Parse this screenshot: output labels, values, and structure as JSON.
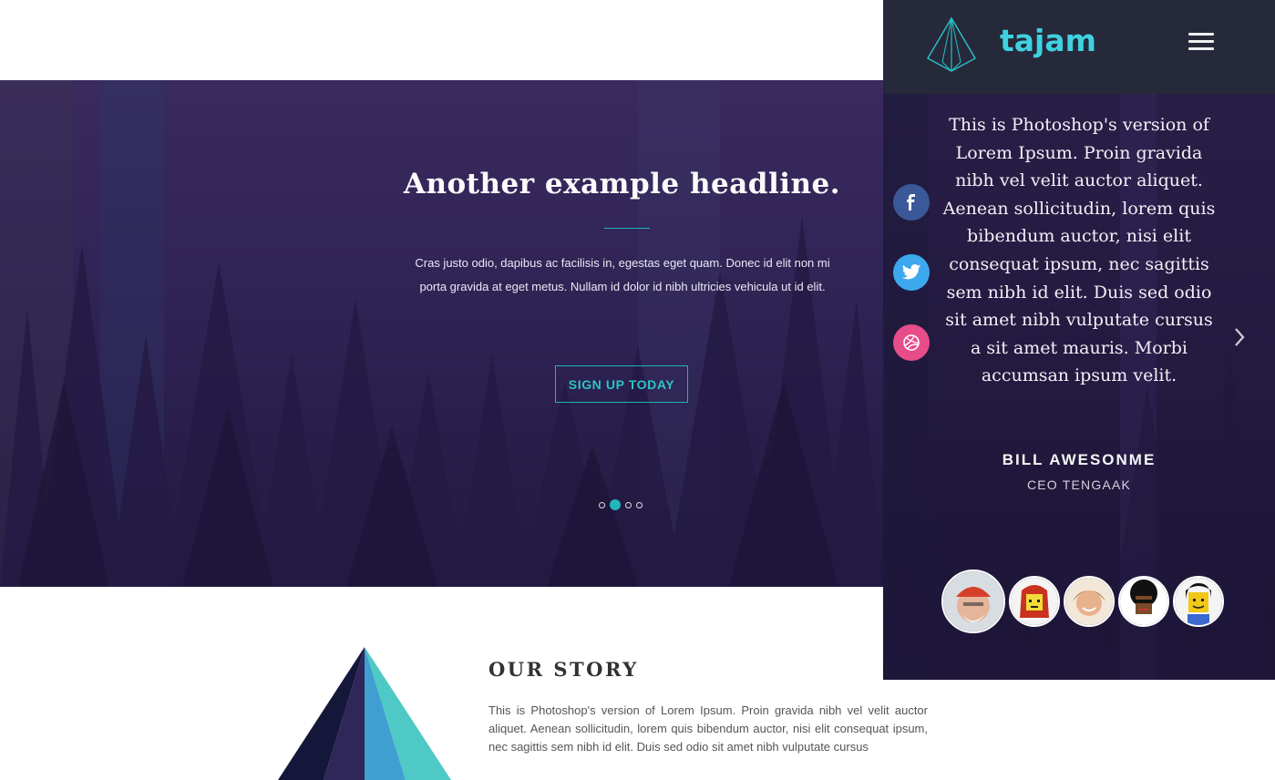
{
  "hero": {
    "title": "Another example headline.",
    "text": "Cras justo odio, dapibus ac facilisis in, egestas eget quam. Donec id elit non mi porta gravida at eget metus. Nullam id dolor id nibh ultricies vehicula ut id elit.",
    "button_label": "SIGN UP TODAY",
    "carousel": {
      "slide_count": 4,
      "active_index": 1
    }
  },
  "story": {
    "title": "OUR STORY",
    "text": "This is Photoshop's version of Lorem Ipsum. Proin gravida nibh vel velit auctor aliquet. Aenean sollicitudin, lorem quis bibendum auctor, nisi elit consequat ipsum, nec sagittis sem nibh id elit. Duis sed odio sit amet nibh vulputate cursus"
  },
  "mobile": {
    "brand": "tajam",
    "menu_icon": "hamburger-icon",
    "social": [
      {
        "name": "facebook",
        "icon": "facebook-icon",
        "color": "#3b5998"
      },
      {
        "name": "twitter",
        "icon": "twitter-icon",
        "color": "#3ea8ef"
      },
      {
        "name": "dribbble",
        "icon": "dribbble-icon",
        "color": "#e74c8b"
      }
    ],
    "testimonial": {
      "quote": "This is Photoshop's version of Lorem Ipsum. Proin gravida nibh vel velit auctor aliquet. Aenean sollicitudin, lorem quis bibendum auctor, nisi elit consequat ipsum, nec sagittis sem nibh id elit. Duis sed odio sit amet nibh vulputate cursus a sit amet mauris. Morbi accumsan ipsum velit.",
      "name": "BILL AWESONME",
      "role": "CEO TENGAAK"
    },
    "avatars": [
      "avatar-1",
      "avatar-2",
      "avatar-3",
      "avatar-4",
      "avatar-5"
    ],
    "active_avatar_index": 0
  },
  "colors": {
    "accent": "#1fb4b8",
    "brand": "#3fd1e0",
    "hero_bg": "#2f2354",
    "header_bg": "#252939"
  }
}
